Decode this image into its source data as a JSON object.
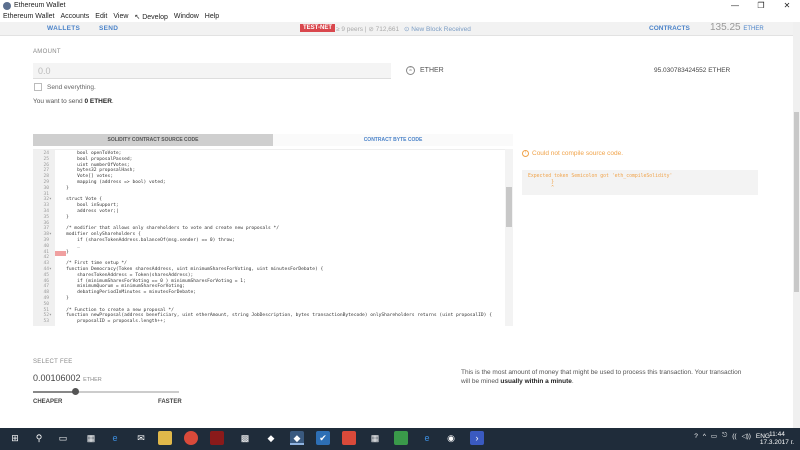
{
  "window": {
    "title": "Ethereum Wallet",
    "controls": [
      "—",
      "❐",
      "✕"
    ]
  },
  "menu": [
    "Ethereum Wallet",
    "Accounts",
    "Edit",
    "View",
    "↖ Develop",
    "Window",
    "Help"
  ],
  "header": {
    "wallets": "WALLETS",
    "send": "SEND",
    "testnet": "TEST-NET",
    "peers": "≥ 9 peers",
    "block": "| ⊘ 712,661",
    "new_block": "⊙ New Block Received",
    "contracts": "CONTRACTS",
    "balance": "135.25",
    "balance_unit": "ETHER"
  },
  "amount": {
    "label": "AMOUNT",
    "placeholder": "0.0",
    "currency": "ETHER",
    "max_balance": "95.030783424552 ETHER",
    "send_everything": "Send everything.",
    "send_msg_prefix": "You want to send ",
    "send_msg_value": "0 ETHER",
    "send_msg_suffix": "."
  },
  "tabs": {
    "source": "SOLIDITY CONTRACT SOURCE CODE",
    "bytecode": "CONTRACT BYTE CODE"
  },
  "code_lines": [
    {
      "n": "24",
      "f": "",
      "t": "        bool openToVote;"
    },
    {
      "n": "25",
      "f": "",
      "t": "        bool proposalPassed;"
    },
    {
      "n": "26",
      "f": "",
      "t": "        uint numberOfVotes;"
    },
    {
      "n": "27",
      "f": "",
      "t": "        bytes32 proposalHash;"
    },
    {
      "n": "28",
      "f": "",
      "t": "        Vote[] votes;"
    },
    {
      "n": "29",
      "f": "",
      "t": "        mapping (address => bool) voted;"
    },
    {
      "n": "30",
      "f": "",
      "t": "    }"
    },
    {
      "n": "31",
      "f": "",
      "t": ""
    },
    {
      "n": "32",
      "f": "▾",
      "t": "    struct Vote {"
    },
    {
      "n": "33",
      "f": "",
      "t": "        bool inSupport;"
    },
    {
      "n": "34",
      "f": "",
      "t": "        address voter;|"
    },
    {
      "n": "35",
      "f": "",
      "t": "    }"
    },
    {
      "n": "36",
      "f": "",
      "t": ""
    },
    {
      "n": "37",
      "f": "",
      "t": "    /* modifier that allows only shareholders to vote and create new proposals */"
    },
    {
      "n": "38",
      "f": "▾",
      "t": "    modifier onlyShareholders {"
    },
    {
      "n": "39",
      "f": "",
      "t": "        if (sharesTokenAddress.balanceOf(msg.sender) == 0) throw;"
    },
    {
      "n": "40",
      "f": "",
      "t": "        _"
    },
    {
      "n": "41",
      "f": "",
      "t": "    }"
    },
    {
      "n": "42",
      "f": "",
      "t": ""
    },
    {
      "n": "43",
      "f": "",
      "t": "    /* First time setup */"
    },
    {
      "n": "44",
      "f": "▾",
      "t": "    function Democracy(Token sharesAddress, uint minimumSharesForVoting, uint minutesForDebate) {"
    },
    {
      "n": "45",
      "f": "",
      "t": "        sharesTokenAddress = Token(sharesAddress);"
    },
    {
      "n": "46",
      "f": "",
      "t": "        if (minimumSharesForVoting == 0 ) minimumSharesForVoting = 1;"
    },
    {
      "n": "47",
      "f": "",
      "t": "        minimumQuorum = minimumSharesForVoting;"
    },
    {
      "n": "48",
      "f": "",
      "t": "        debatingPeriodInMinutes = minutesForDebate;"
    },
    {
      "n": "49",
      "f": "",
      "t": "    }"
    },
    {
      "n": "50",
      "f": "",
      "t": ""
    },
    {
      "n": "51",
      "f": "",
      "t": "    /* Function to create a new proposal */"
    },
    {
      "n": "52",
      "f": "▾",
      "t": "    function newProposal(address beneficiary, uint etherAmount, string JobDescription, bytes transactionBytecode) onlyShareholders returns (uint proposalID) {"
    },
    {
      "n": "53",
      "f": "",
      "t": "        proposalID = proposals.length++;"
    }
  ],
  "error": {
    "title": "Could not compile source code.",
    "message": "Expected token Semicolon got 'eth_compileSolidity'\n        }\n        ^"
  },
  "fee": {
    "label": "SELECT FEE",
    "value": "0.00106002",
    "unit": "ETHER",
    "level": 0.29,
    "cheaper": "CHEAPER",
    "faster": "FASTER",
    "note_prefix": "This is the most amount of money that might be used to process this transaction. Your transaction will be mined ",
    "note_bold": "usually within a minute",
    "note_suffix": "."
  },
  "taskbar": {
    "tray": [
      "?",
      "^",
      "▭",
      "⎋",
      "((",
      "◁))",
      "ENG"
    ],
    "time": "11:44",
    "date": "17.3.2017 г."
  },
  "colors": {
    "accent": "#4b83c9",
    "testnet": "#d9474d",
    "error": "#f0a34a"
  }
}
